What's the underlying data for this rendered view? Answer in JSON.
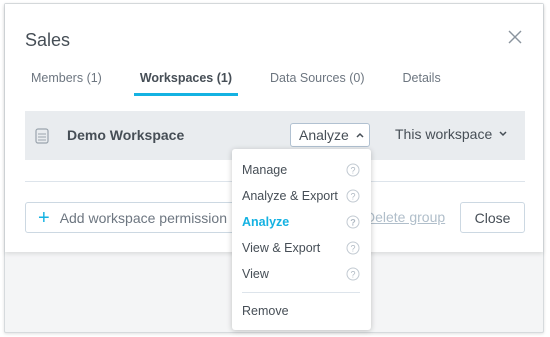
{
  "dialog": {
    "title": "Sales"
  },
  "tabs": [
    {
      "label": "Members (1)",
      "active": false
    },
    {
      "label": "Workspaces (1)",
      "active": true
    },
    {
      "label": "Data Sources (0)",
      "active": false
    },
    {
      "label": "Details",
      "active": false
    }
  ],
  "workspace_row": {
    "name": "Demo Workspace",
    "permission": "Analyze",
    "scope": "This workspace"
  },
  "permission_menu": {
    "items": [
      {
        "label": "Manage",
        "help": true
      },
      {
        "label": "Analyze & Export",
        "help": true
      },
      {
        "label": "Analyze",
        "help": true,
        "selected": true
      },
      {
        "label": "View & Export",
        "help": true
      },
      {
        "label": "View",
        "help": true
      }
    ],
    "remove_label": "Remove"
  },
  "footer": {
    "add_label": "Add workspace permission",
    "delete_label": "Delete group",
    "close_label": "Close"
  },
  "colors": {
    "accent": "#14b2e2",
    "text": "#464e56",
    "row_bg": "#e9ecef"
  },
  "icons": {
    "close": "close-icon",
    "workspace": "workspace-icon",
    "chevron_up": "chevron-up-icon",
    "chevron_down": "chevron-down-icon",
    "help": "help-icon",
    "plus": "plus-icon"
  }
}
